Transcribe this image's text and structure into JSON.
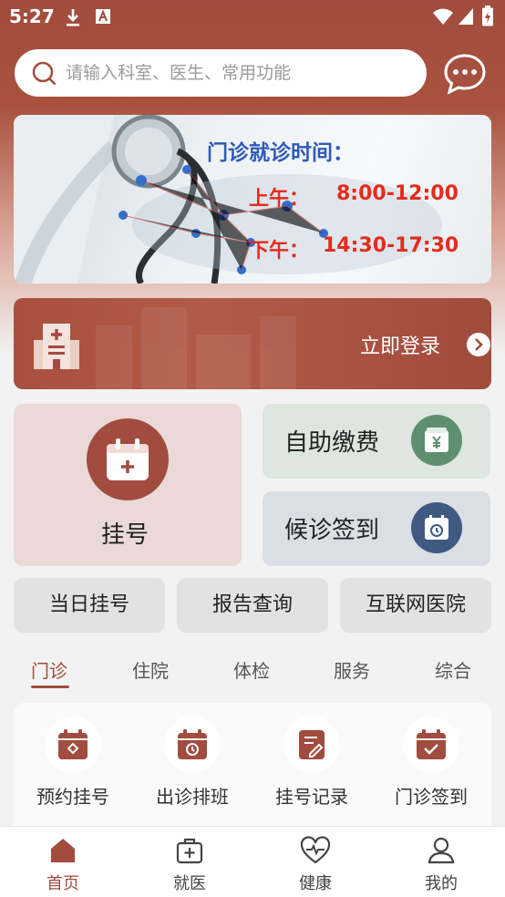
{
  "status_bar": {
    "time": "5:27"
  },
  "search": {
    "placeholder": "请输入科室、医生、常用功能"
  },
  "banner": {
    "title": "门诊就诊时间：",
    "am_label": "上午：",
    "am_time": "8:00-12:00",
    "pm_label": "下午：",
    "pm_time": "14:30-17:30"
  },
  "login": {
    "label": "立即登录"
  },
  "cards": {
    "register": "挂号",
    "self_pay": "自助缴费",
    "checkin_wait": "候诊签到"
  },
  "quick": [
    "当日挂号",
    "报告查询",
    "互联网医院"
  ],
  "tabs": [
    "门诊",
    "住院",
    "体检",
    "服务",
    "综合"
  ],
  "functions": [
    "预约挂号",
    "出诊排班",
    "挂号记录",
    "门诊签到"
  ],
  "bottom_nav": [
    "首页",
    "就医",
    "健康",
    "我的"
  ],
  "colors": {
    "brand": "#a14c3e",
    "pay_icon": "#5f8f6e",
    "wait_icon": "#3f5a80"
  }
}
